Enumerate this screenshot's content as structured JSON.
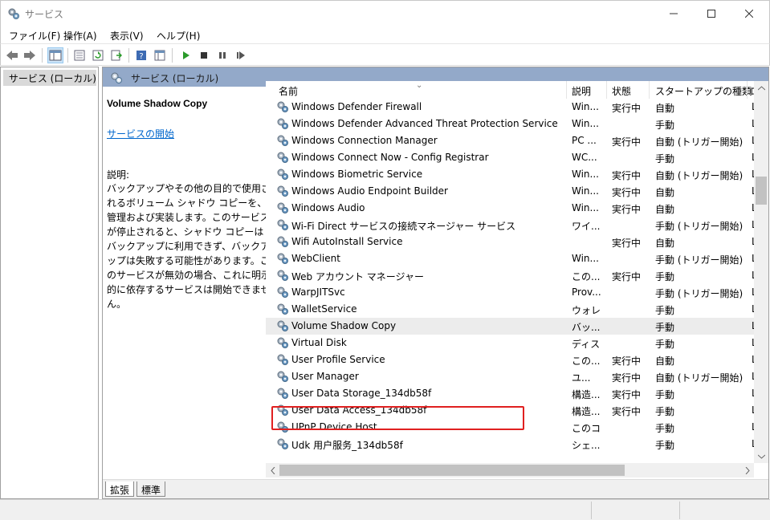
{
  "window": {
    "title": "サービス"
  },
  "menu": [
    "ファイル(F)",
    "操作(A)",
    "表示(V)",
    "ヘルプ(H)"
  ],
  "toolbar": {
    "buttons": [
      "back-icon",
      "forward-icon",
      "show-tree-icon",
      "properties-icon",
      "refresh-icon",
      "export-icon",
      "help-icon",
      "console-icon",
      "start-icon",
      "stop-icon",
      "pause-icon",
      "restart-icon"
    ]
  },
  "tree": {
    "root_label": "サービス (ローカル)"
  },
  "main": {
    "header_title": "サービス (ローカル)",
    "selected_service": "Volume Shadow Copy",
    "start_link": "サービスの開始",
    "description_label": "説明:",
    "description_text": "バックアップやその他の目的で使用されるボリューム シャドウ コピーを、管理および実装します。このサービスが停止されると、シャドウ コピーはバックアップに利用できず、バックアップは失敗する可能性があります。このサービスが無効の場合、これに明示的に依存するサービスは開始できません。"
  },
  "columns": {
    "name": "名前",
    "description": "説明",
    "status": "状態",
    "startup": "スタートアップの種類",
    "logon": "ロ"
  },
  "services": [
    {
      "name": "Windows Defender Firewall",
      "desc": "Win...",
      "status": "実行中",
      "startup": "自動",
      "logon": "L"
    },
    {
      "name": "Windows Defender Advanced Threat Protection Service",
      "desc": "Win...",
      "status": "",
      "startup": "手動",
      "logon": "L"
    },
    {
      "name": "Windows Connection Manager",
      "desc": "PC ...",
      "status": "実行中",
      "startup": "自動 (トリガー開始)",
      "logon": "L"
    },
    {
      "name": "Windows Connect Now - Config Registrar",
      "desc": "WC...",
      "status": "",
      "startup": "手動",
      "logon": "L"
    },
    {
      "name": "Windows Biometric Service",
      "desc": "Win...",
      "status": "実行中",
      "startup": "自動 (トリガー開始)",
      "logon": "L"
    },
    {
      "name": "Windows Audio Endpoint Builder",
      "desc": "Win...",
      "status": "実行中",
      "startup": "自動",
      "logon": "L"
    },
    {
      "name": "Windows Audio",
      "desc": "Win...",
      "status": "実行中",
      "startup": "自動",
      "logon": "L"
    },
    {
      "name": "Wi-Fi Direct サービスの接続マネージャー サービス",
      "desc": "ワイ...",
      "status": "",
      "startup": "手動 (トリガー開始)",
      "logon": "L"
    },
    {
      "name": "Wifi AutoInstall Service",
      "desc": "",
      "status": "実行中",
      "startup": "自動",
      "logon": "L"
    },
    {
      "name": "WebClient",
      "desc": "Win...",
      "status": "",
      "startup": "手動 (トリガー開始)",
      "logon": "L"
    },
    {
      "name": "Web アカウント マネージャー",
      "desc": "この...",
      "status": "実行中",
      "startup": "手動",
      "logon": "L"
    },
    {
      "name": "WarpJITSvc",
      "desc": "Prov...",
      "status": "",
      "startup": "手動 (トリガー開始)",
      "logon": "L"
    },
    {
      "name": "WalletService",
      "desc": "ウォレ...",
      "status": "",
      "startup": "手動",
      "logon": "L"
    },
    {
      "name": "Volume Shadow Copy",
      "desc": "バッ...",
      "status": "",
      "startup": "手動",
      "logon": "L"
    },
    {
      "name": "Virtual Disk",
      "desc": "ディス...",
      "status": "",
      "startup": "手動",
      "logon": "L"
    },
    {
      "name": "User Profile Service",
      "desc": "この...",
      "status": "実行中",
      "startup": "自動",
      "logon": "L"
    },
    {
      "name": "User Manager",
      "desc": "ユ...",
      "status": "実行中",
      "startup": "自動 (トリガー開始)",
      "logon": "L"
    },
    {
      "name": "User Data Storage_134db58f",
      "desc": "構造...",
      "status": "実行中",
      "startup": "手動",
      "logon": "L"
    },
    {
      "name": "User Data Access_134db58f",
      "desc": "構造...",
      "status": "実行中",
      "startup": "手動",
      "logon": "L"
    },
    {
      "name": "UPnP Device Host",
      "desc": "このコ...",
      "status": "",
      "startup": "手動",
      "logon": "L"
    },
    {
      "name": "Udk 用户服务_134db58f",
      "desc": "シェ...",
      "status": "",
      "startup": "手動",
      "logon": "L"
    }
  ],
  "tabs": [
    "拡張",
    "標準"
  ],
  "colors": {
    "header_bg": "#93a9c9",
    "highlight_box": "#e02020",
    "link": "#0066cc"
  }
}
